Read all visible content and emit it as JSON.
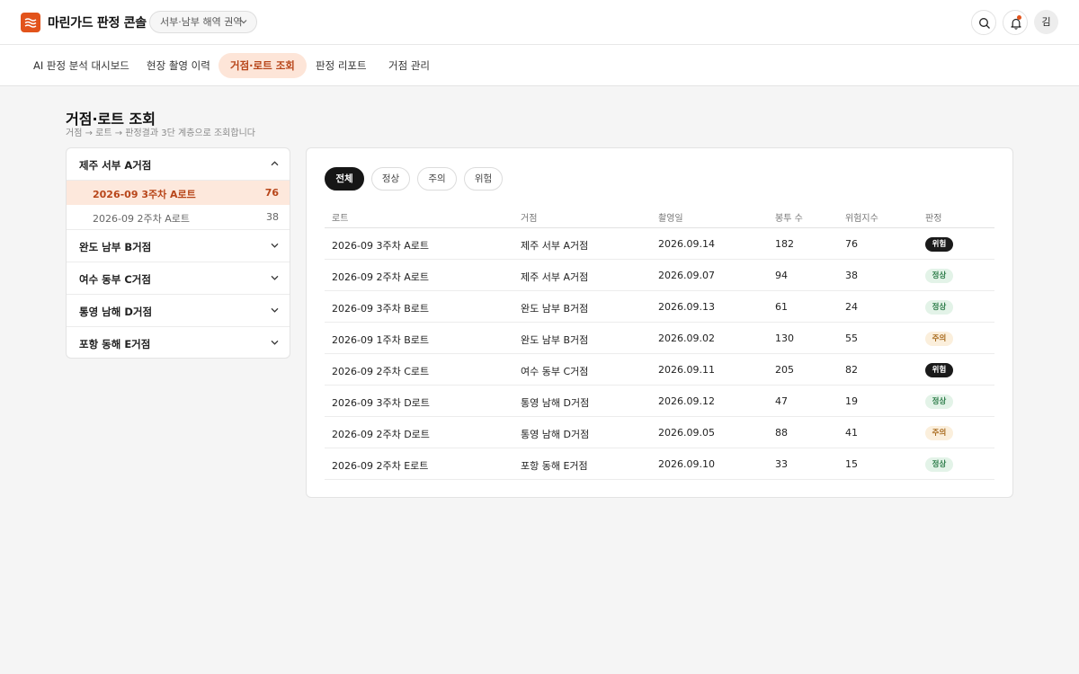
{
  "app": {
    "title": "마린가드 판정 콘솔",
    "region": "서부·남부 해역 권역",
    "avatar_initial": "김",
    "accent": "#e2531b"
  },
  "tabs": [
    {
      "label": "AI 판정 분석 대시보드",
      "active": false
    },
    {
      "label": "현장 촬영 이력",
      "active": false
    },
    {
      "label": "거점·로트 조회",
      "active": true
    },
    {
      "label": "판정 리포트",
      "active": false
    },
    {
      "label": "거점 관리",
      "active": false
    }
  ],
  "page": {
    "title": "거점·로트 조회",
    "subtitle": "거점 → 로트 → 판정결과 3단 계층으로 조회합니다"
  },
  "sidebar": {
    "sites": [
      {
        "name": "제주 서부 A거점",
        "expanded": true,
        "lots": [
          {
            "name": "2026-09 3주차 A로트",
            "count": "76",
            "selected": true
          },
          {
            "name": "2026-09 2주차 A로트",
            "count": "38",
            "selected": false
          }
        ]
      },
      {
        "name": "완도 남부 B거점",
        "expanded": false
      },
      {
        "name": "여수 동부 C거점",
        "expanded": false
      },
      {
        "name": "통영 남해 D거점",
        "expanded": false
      },
      {
        "name": "포항 동해 E거점",
        "expanded": false
      }
    ]
  },
  "filters": [
    {
      "label": "전체",
      "active": true
    },
    {
      "label": "정상",
      "active": false
    },
    {
      "label": "주의",
      "active": false
    },
    {
      "label": "위험",
      "active": false
    }
  ],
  "table": {
    "headers": [
      "로트",
      "거점",
      "촬영일",
      "봉투 수",
      "위험지수",
      "판정"
    ],
    "rows": [
      [
        "2026-09 3주차 A로트",
        "제주 서부 A거점",
        "2026.09.14",
        "182",
        "76",
        "위험"
      ],
      [
        "2026-09 2주차 A로트",
        "제주 서부 A거점",
        "2026.09.07",
        "94",
        "38",
        "정상"
      ],
      [
        "2026-09 3주차 B로트",
        "완도 남부 B거점",
        "2026.09.13",
        "61",
        "24",
        "정상"
      ],
      [
        "2026-09 1주차 B로트",
        "완도 남부 B거점",
        "2026.09.02",
        "130",
        "55",
        "주의"
      ],
      [
        "2026-09 2주차 C로트",
        "여수 동부 C거점",
        "2026.09.11",
        "205",
        "82",
        "위험"
      ],
      [
        "2026-09 3주차 D로트",
        "통영 남해 D거점",
        "2026.09.12",
        "47",
        "19",
        "정상"
      ],
      [
        "2026-09 2주차 D로트",
        "통영 남해 D거점",
        "2026.09.05",
        "88",
        "41",
        "주의"
      ],
      [
        "2026-09 2주차 E로트",
        "포항 동해 E거점",
        "2026.09.10",
        "33",
        "15",
        "정상"
      ]
    ]
  },
  "status_colors": {
    "위험": {
      "bg": "#1a1a1a",
      "fg": "#ffffff"
    },
    "정상": {
      "bg": "#e3f3e8",
      "fg": "#2e7d4a"
    },
    "주의": {
      "bg": "#fbefdc",
      "fg": "#a86a1d"
    }
  }
}
